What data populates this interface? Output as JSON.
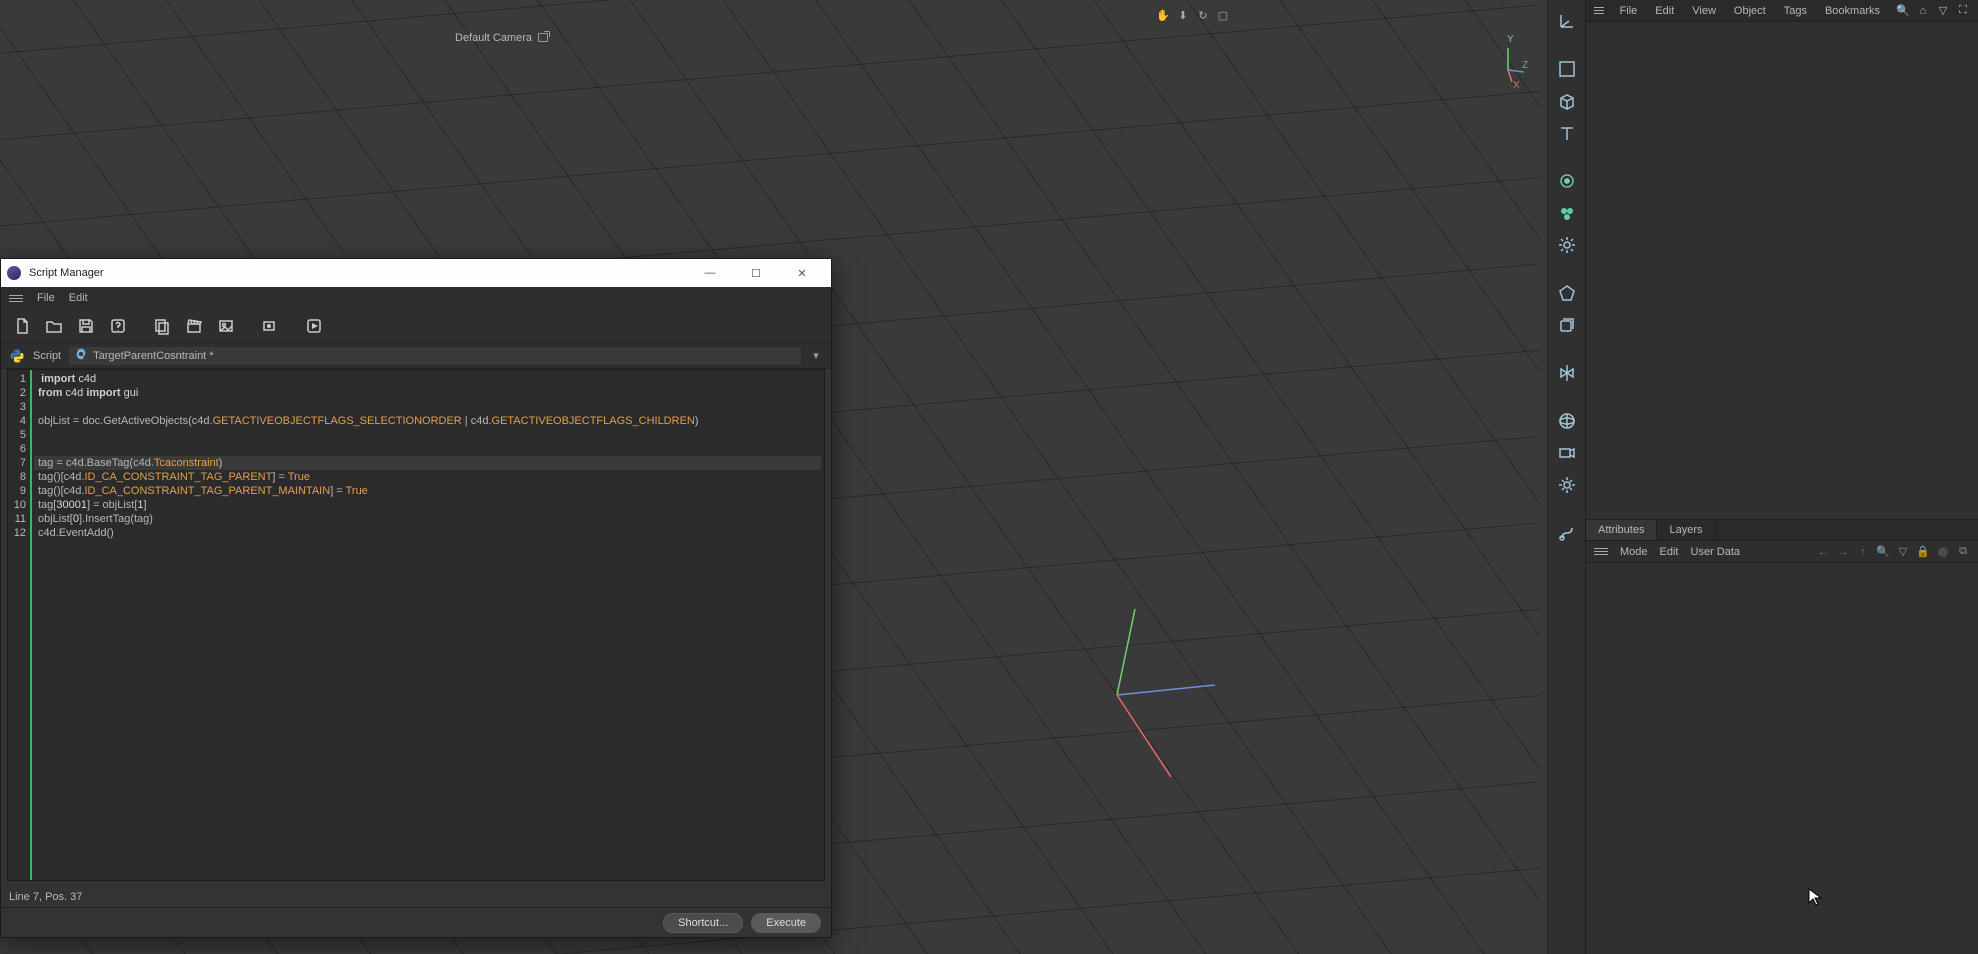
{
  "viewport": {
    "camera_label": "Default Camera"
  },
  "axis_widget": {
    "y": "Y",
    "x": "X",
    "z": "Z"
  },
  "object_manager": {
    "menu": {
      "file": "File",
      "edit": "Edit",
      "view": "View",
      "object": "Object",
      "tags": "Tags",
      "bookmarks": "Bookmarks"
    }
  },
  "attributes": {
    "tabs": {
      "attributes": "Attributes",
      "layers": "Layers"
    },
    "bar": {
      "mode": "Mode",
      "edit": "Edit",
      "user_data": "User Data"
    }
  },
  "script_manager": {
    "title": "Script Manager",
    "menu": {
      "file": "File",
      "edit": "Edit"
    },
    "script_label": "Script",
    "script_name": "TargetParentCosntraint *",
    "status": "Line 7, Pos. 37",
    "buttons": {
      "shortcut": "Shortcut...",
      "execute": "Execute"
    },
    "code": {
      "line_numbers": [
        "1",
        "2",
        "3",
        "4",
        "5",
        "6",
        "7",
        "8",
        "9",
        "10",
        "11",
        "12"
      ],
      "cursor_line_index": 6,
      "lines": [
        [
          {
            "t": " ",
            "c": ""
          },
          {
            "t": "import",
            "c": "tok-kw"
          },
          {
            "t": " c4d",
            "c": "tok-mod"
          }
        ],
        [
          {
            "t": "from",
            "c": "tok-kw"
          },
          {
            "t": " c4d ",
            "c": "tok-mod"
          },
          {
            "t": "import",
            "c": "tok-kw"
          },
          {
            "t": " gui",
            "c": "tok-mod"
          }
        ],
        [],
        [
          {
            "t": "objList = doc.GetActiveObjects(c4d.",
            "c": ""
          },
          {
            "t": "GETACTIVEOBJECTFLAGS_SELECTIONORDER",
            "c": "tok-const"
          },
          {
            "t": " | c4d.",
            "c": ""
          },
          {
            "t": "GETACTIVEOBJECTFLAGS_CHILDREN",
            "c": "tok-const"
          },
          {
            "t": ")",
            "c": "tok-punc"
          }
        ],
        [],
        [],
        [
          {
            "t": "tag = c4d.BaseTag(c4d.",
            "c": ""
          },
          {
            "t": "Tcaconstraint",
            "c": "tok-const"
          },
          {
            "t": ")",
            "c": "tok-punc"
          }
        ],
        [
          {
            "t": "tag()[c4d.",
            "c": ""
          },
          {
            "t": "ID_CA_CONSTRAINT_TAG_PARENT",
            "c": "tok-const"
          },
          {
            "t": "] = ",
            "c": ""
          },
          {
            "t": "True",
            "c": "tok-bool"
          }
        ],
        [
          {
            "t": "tag()[c4d.",
            "c": ""
          },
          {
            "t": "ID_CA_CONSTRAINT_TAG_PARENT_MAINTAIN",
            "c": "tok-const"
          },
          {
            "t": "] = ",
            "c": ""
          },
          {
            "t": "True",
            "c": "tok-bool"
          }
        ],
        [
          {
            "t": "tag[",
            "c": ""
          },
          {
            "t": "30001",
            "c": "tok-num"
          },
          {
            "t": "] = objList[",
            "c": ""
          },
          {
            "t": "1",
            "c": "tok-num"
          },
          {
            "t": "]",
            "c": "tok-punc"
          }
        ],
        [
          {
            "t": "objList[",
            "c": ""
          },
          {
            "t": "0",
            "c": "tok-num"
          },
          {
            "t": "].InsertTag(tag)",
            "c": ""
          }
        ],
        [
          {
            "t": "c4d.EventAdd()",
            "c": ""
          }
        ]
      ]
    }
  }
}
